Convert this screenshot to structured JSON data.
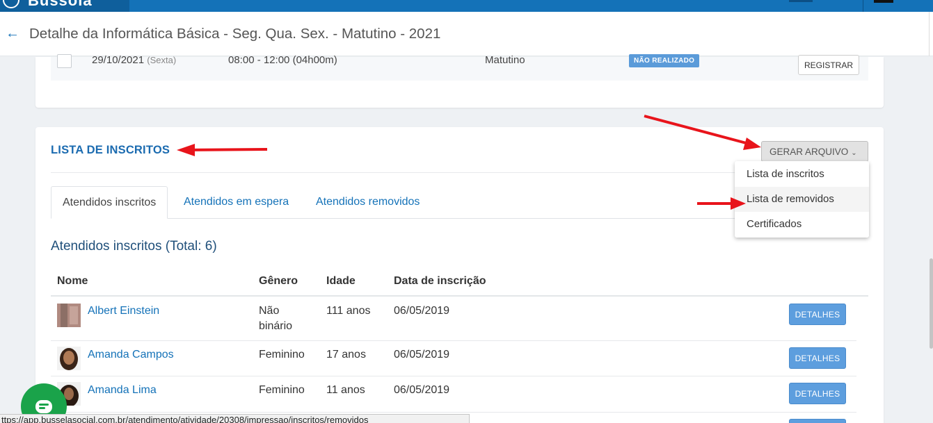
{
  "header": {
    "back_icon": "arrow-left-icon",
    "title": "Detalhe da Informática Básica - Seg. Qua. Sex. - Matutino - 2021"
  },
  "schedule_row": {
    "date": "29/10/2021",
    "day": "(Sexta)",
    "time": "08:00 - 12:00 (04h00m)",
    "shift": "Matutino",
    "status": "NÃO REALIZADO",
    "register_label": "REGISTRAR"
  },
  "section": {
    "title": "LISTA DE INSCRITOS",
    "generate_label": "GERAR ARQUIVO",
    "dropdown": [
      "Lista de inscritos",
      "Lista de removidos",
      "Certificados"
    ]
  },
  "tabs": [
    "Atendidos inscritos",
    "Atendidos em espera",
    "Atendidos removidos"
  ],
  "list_title": "Atendidos inscritos (Total: 6)",
  "table": {
    "headers": [
      "Nome",
      "Gênero",
      "Idade",
      "Data de inscrição"
    ],
    "rows": [
      {
        "name": "Albert Einstein",
        "gender_line1": "Não",
        "gender_line2": "binário",
        "age": "111 anos",
        "date": "06/05/2019",
        "action": "DETALHES"
      },
      {
        "name": "Amanda Campos",
        "gender_line1": "Feminino",
        "gender_line2": "",
        "age": "17 anos",
        "date": "06/05/2019",
        "action": "DETALHES"
      },
      {
        "name": "Amanda Lima",
        "gender_line1": "Feminino",
        "gender_line2": "",
        "age": "11 anos",
        "date": "06/05/2019",
        "action": "DETALHES"
      }
    ]
  },
  "status_bar_url": "ttps://app.busselasocial.com.br/atendimento/atividade/20308/impressao/inscritos/removidos",
  "colors": {
    "brand_blue": "#1472b8",
    "annotation_red": "#e8141b",
    "chat_green": "#1aa34a"
  }
}
